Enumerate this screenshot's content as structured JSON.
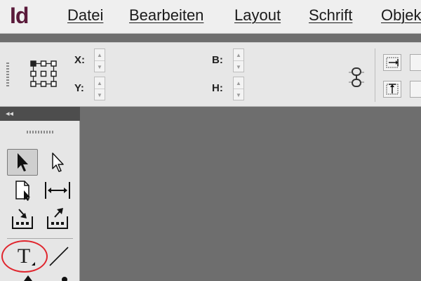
{
  "app": {
    "logo": "Id"
  },
  "menu": {
    "items": [
      "Datei",
      "Bearbeiten",
      "Layout",
      "Schrift",
      "Objekt"
    ]
  },
  "control_bar": {
    "x_label": "X:",
    "y_label": "Y:",
    "w_label": "B:",
    "h_label": "H:"
  },
  "tool_panel": {
    "header_label": "◂◂",
    "tools": [
      {
        "name": "selection-tool",
        "icon": "black-arrow-icon",
        "selected": true
      },
      {
        "name": "direct-selection-tool",
        "icon": "white-arrow-icon"
      },
      {
        "name": "page-tool",
        "icon": "page-icon"
      },
      {
        "name": "gap-tool",
        "icon": "gap-icon"
      },
      {
        "name": "content-collector-tool",
        "icon": "collector-icon"
      },
      {
        "name": "content-placer-tool",
        "icon": "placer-icon"
      },
      {
        "name": "type-tool",
        "icon": "type-t-icon",
        "glyph": "T",
        "highlighted": true
      },
      {
        "name": "line-tool",
        "icon": "line-icon"
      }
    ]
  },
  "colors": {
    "menubar": "#efefef",
    "canvas": "#6e6e6e",
    "highlight": "#e0262e",
    "logo": "#5a1a3a"
  }
}
